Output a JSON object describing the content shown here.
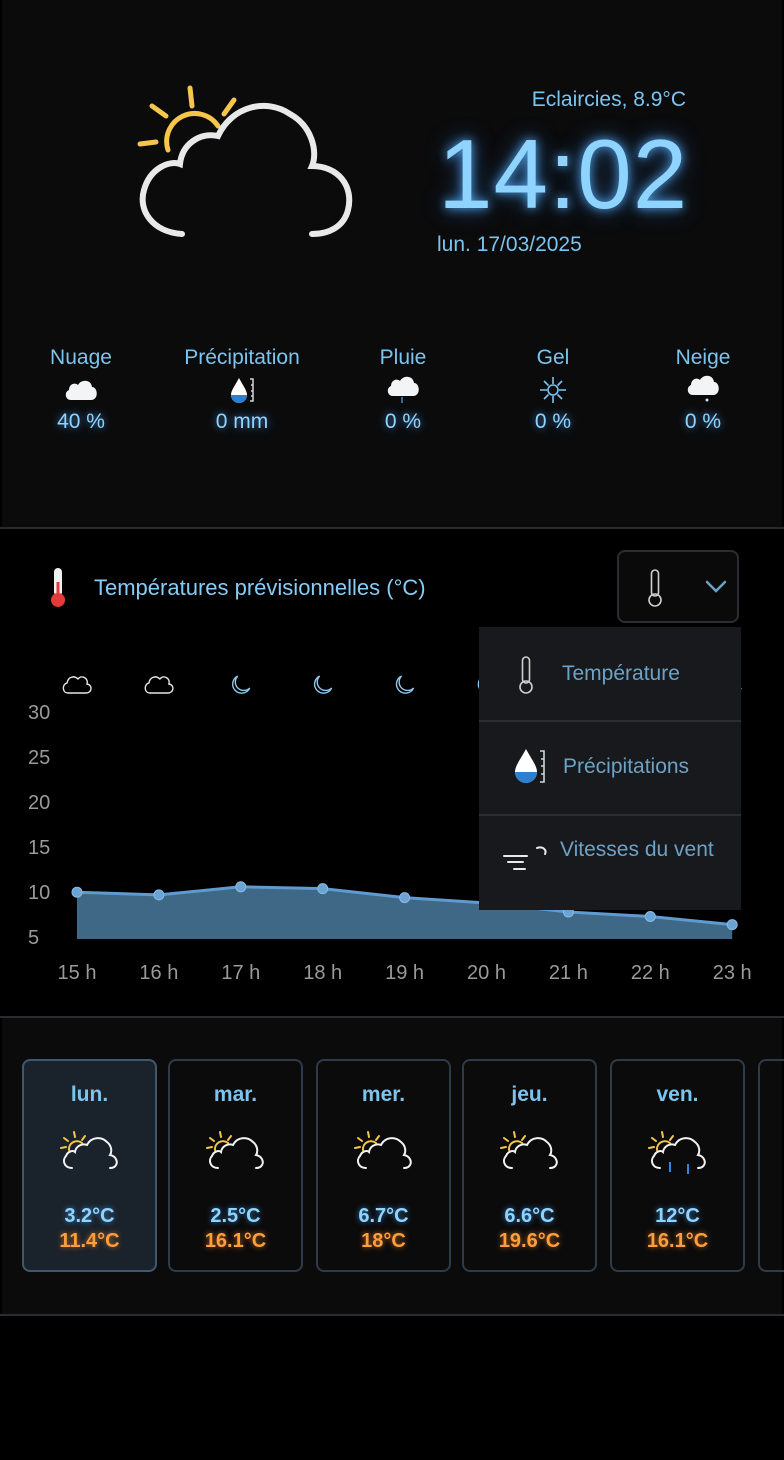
{
  "current": {
    "condition": "Eclaircies, 8.9°C",
    "time": "14:02",
    "date": "lun. 17/03/2025"
  },
  "stats": [
    {
      "label": "Nuage",
      "value": "40 %",
      "icon": "cloud-icon"
    },
    {
      "label": "Précipitation",
      "value": "0 mm",
      "icon": "rain-gauge-icon"
    },
    {
      "label": "Pluie",
      "value": "0 %",
      "icon": "rain-cloud-icon"
    },
    {
      "label": "Gel",
      "value": "0 %",
      "icon": "frost-icon"
    },
    {
      "label": "Neige",
      "value": "0 %",
      "icon": "snow-cloud-icon"
    }
  ],
  "forecast_chart": {
    "title": "Températures prévisionnelles (°C)",
    "selector_icon": "thermometer-icon",
    "menu": [
      {
        "label": "Température",
        "icon": "thermometer-icon"
      },
      {
        "label": "Précipitations",
        "icon": "rain-gauge-icon"
      },
      {
        "label": "Vitesses du vent",
        "icon": "wind-icon"
      }
    ]
  },
  "chart_data": {
    "type": "area",
    "title": "Températures prévisionnelles (°C)",
    "categories": [
      "15 h",
      "16 h",
      "17 h",
      "18 h",
      "19 h",
      "20 h",
      "21 h",
      "22 h",
      "23 h"
    ],
    "values": [
      10.2,
      9.9,
      10.8,
      10.6,
      9.6,
      9.0,
      8.0,
      7.5,
      6.6
    ],
    "hour_icons": [
      "cloud-icon",
      "cloud-icon",
      "moon-icon",
      "moon-icon",
      "moon-icon",
      "moon-icon",
      "moon-icon",
      "moon-icon",
      "moon-icon"
    ],
    "ylim": [
      5,
      30
    ],
    "yticks": [
      30,
      25,
      20,
      15,
      10,
      5
    ],
    "colors": {
      "fill": "#3e6885",
      "line": "#5f9bd0",
      "point": "#6aa3d6"
    }
  },
  "days": [
    {
      "name": "lun.",
      "min": "3.2°C",
      "max": "11.4°C",
      "icon": "sun-cloud-icon",
      "selected": true
    },
    {
      "name": "mar.",
      "min": "2.5°C",
      "max": "16.1°C",
      "icon": "sun-cloud-icon"
    },
    {
      "name": "mer.",
      "min": "6.7°C",
      "max": "18°C",
      "icon": "sun-cloud-icon"
    },
    {
      "name": "jeu.",
      "min": "6.6°C",
      "max": "19.6°C",
      "icon": "sun-cloud-icon"
    },
    {
      "name": "ven.",
      "min": "12°C",
      "max": "16.1°C",
      "icon": "sun-cloud-rain-icon"
    }
  ],
  "colors": {
    "accent": "#8fd4ff",
    "max_temp": "#ff9e3d",
    "panel": "#0b0b0c"
  }
}
